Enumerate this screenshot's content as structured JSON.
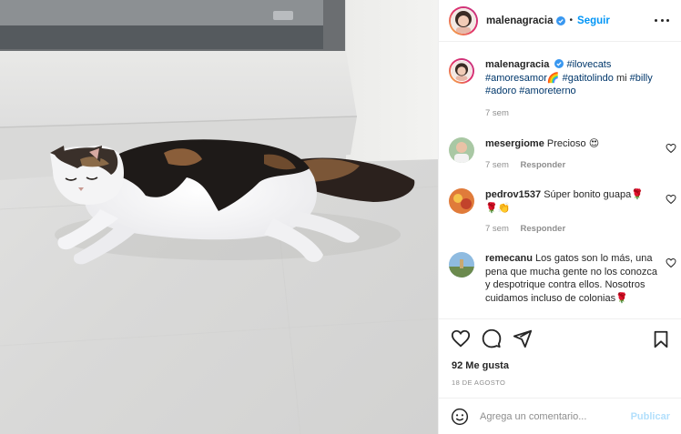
{
  "post": {
    "author": "malenagracia",
    "follow_label": "Seguir",
    "separator": "•",
    "caption": {
      "author": "malenagracia",
      "hashtags_line1": "#ilovecats",
      "hashtags_line2a": "#amoresamor",
      "emoji_rainbow": "🌈",
      "hashtags_line2b": "#gatitolindo",
      "word_mi": "mi",
      "tag_billy": "#billy",
      "hashtags_line3": "#adoro #amoreterno",
      "time": "7 sem"
    },
    "comments": [
      {
        "user": "mesergiome",
        "text": "Precioso 😍",
        "time": "7 sem",
        "reply": "Responder"
      },
      {
        "user": "pedrov1537",
        "text": "Súper bonito guapa🌹",
        "text2": "🌹👏",
        "time": "7 sem",
        "reply": "Responder"
      },
      {
        "user": "remecanu",
        "text": "Los gatos son lo más, una pena que mucha gente no los conozca y despotrique contra ellos. Nosotros cuidamos incluso de colonias🌹",
        "time": "",
        "reply": ""
      }
    ],
    "likes": "92 Me gusta",
    "date": "18 DE AGOSTO",
    "comment_placeholder": "Agrega un comentario...",
    "publish_label": "Publicar"
  },
  "colors": {
    "link_blue": "#0095f6",
    "hashtag_blue": "#00376b",
    "muted": "#8e8e8e",
    "publish_disabled": "#b2dffc"
  },
  "icons": [
    "verified-icon",
    "more-options-icon",
    "heart-icon",
    "comment-icon",
    "share-icon",
    "save-icon",
    "emoji-icon"
  ]
}
